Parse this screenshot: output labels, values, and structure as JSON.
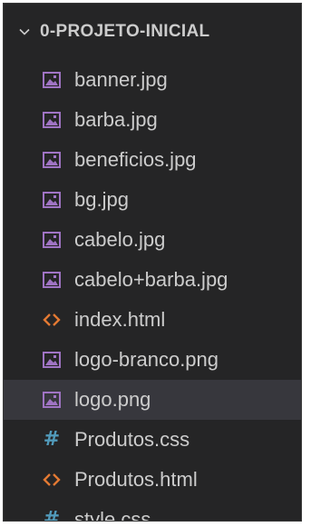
{
  "explorer": {
    "folder_name": "0-PROJETO-INICIAL",
    "files": [
      {
        "name": "banner.jpg",
        "icon": "image-file-icon",
        "type": "image"
      },
      {
        "name": "barba.jpg",
        "icon": "image-file-icon",
        "type": "image"
      },
      {
        "name": "beneficios.jpg",
        "icon": "image-file-icon",
        "type": "image"
      },
      {
        "name": "bg.jpg",
        "icon": "image-file-icon",
        "type": "image"
      },
      {
        "name": "cabelo.jpg",
        "icon": "image-file-icon",
        "type": "image"
      },
      {
        "name": "cabelo+barba.jpg",
        "icon": "image-file-icon",
        "type": "image"
      },
      {
        "name": "index.html",
        "icon": "html-file-icon",
        "type": "html"
      },
      {
        "name": "logo-branco.png",
        "icon": "image-file-icon",
        "type": "image"
      },
      {
        "name": "logo.png",
        "icon": "image-file-icon",
        "type": "image",
        "selected": true
      },
      {
        "name": "Produtos.css",
        "icon": "css-file-icon",
        "type": "css"
      },
      {
        "name": "Produtos.html",
        "icon": "html-file-icon",
        "type": "html"
      },
      {
        "name": "style.css",
        "icon": "css-file-icon",
        "type": "css"
      }
    ]
  },
  "colors": {
    "background": "#252526",
    "text": "#cccccc",
    "selected_row": "#37373d",
    "image_icon": "#a074c4",
    "html_icon": "#e37933",
    "css_icon": "#519aba"
  }
}
